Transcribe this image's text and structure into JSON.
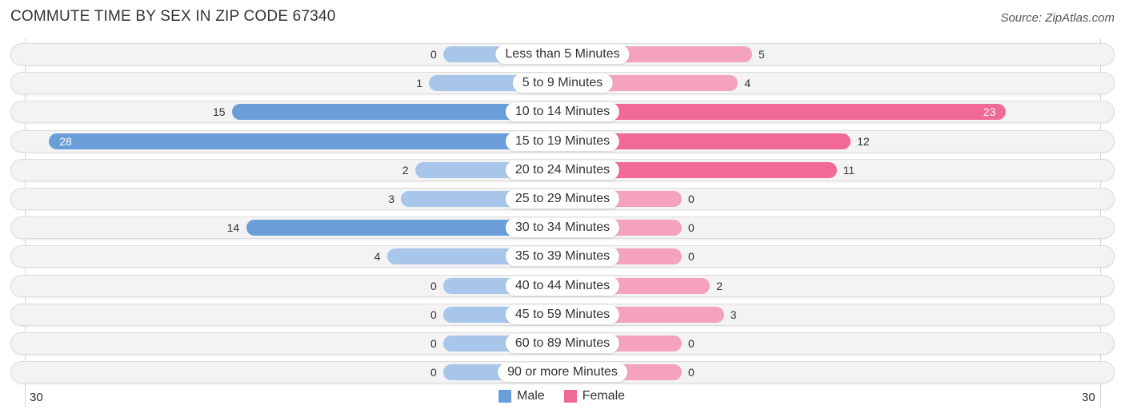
{
  "header": {
    "title": "COMMUTE TIME BY SEX IN ZIP CODE 67340",
    "source": "Source: ZipAtlas.com"
  },
  "colors": {
    "male_light": "#a8c6ea",
    "male_strong": "#6a9ed9",
    "female_light": "#f5a3bd",
    "female_strong": "#f06a95",
    "row_background": "#f3f3f3"
  },
  "legend": {
    "male_label": "Male",
    "female_label": "Female"
  },
  "axis": {
    "left_label": "30",
    "right_label": "30"
  },
  "chart_data": {
    "type": "bar",
    "orientation": "horizontal-diverging",
    "title": "COMMUTE TIME BY SEX IN ZIP CODE 67340",
    "source": "Source: ZipAtlas.com",
    "xlim": [
      -30,
      30
    ],
    "x_tick_labels": [
      "30",
      "30"
    ],
    "legend_position": "bottom-center",
    "categories": [
      "Less than 5 Minutes",
      "5 to 9 Minutes",
      "10 to 14 Minutes",
      "15 to 19 Minutes",
      "20 to 24 Minutes",
      "25 to 29 Minutes",
      "30 to 34 Minutes",
      "35 to 39 Minutes",
      "40 to 44 Minutes",
      "45 to 59 Minutes",
      "60 to 89 Minutes",
      "90 or more Minutes"
    ],
    "series": [
      {
        "name": "Male",
        "color": "#6a9ed9",
        "values": [
          0,
          1,
          15,
          28,
          2,
          3,
          14,
          4,
          0,
          0,
          0,
          0
        ]
      },
      {
        "name": "Female",
        "color": "#f06a95",
        "values": [
          5,
          4,
          23,
          12,
          11,
          0,
          0,
          0,
          2,
          3,
          0,
          0
        ]
      }
    ]
  }
}
